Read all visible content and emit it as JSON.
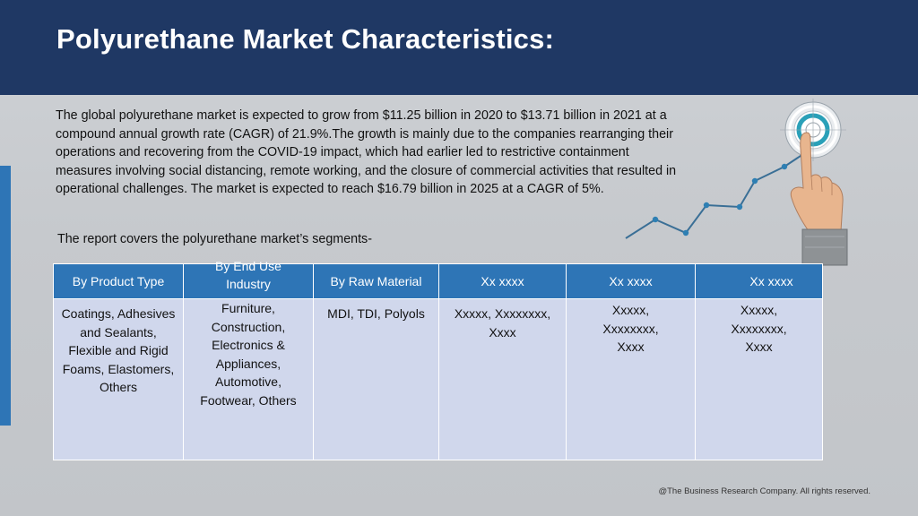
{
  "slide": {
    "title": "Polyurethane Market Characteristics:",
    "intro": "The global polyurethane market is expected to grow from $11.25 billion in 2020 to $13.71 billion in 2021 at a compound annual growth rate (CAGR) of 21.9%.The growth is mainly due to the companies rearranging their operations and recovering from the COVID-19 impact, which had earlier led to restrictive containment measures involving social distancing, remote working, and the closure of commercial activities that resulted in operational challenges. The market is expected to reach $16.79 billion in 2025 at a CAGR of 5%.",
    "segments_note": "The report covers the polyurethane market’s segments-",
    "footer": "@The Business Research Company. All rights reserved."
  },
  "table": {
    "headers": [
      "By Product Type",
      "By End Use Industry",
      "By Raw Material",
      "Xx xxxx",
      "Xx xxxx",
      "Xx xxxx"
    ],
    "cells": [
      "Coatings, Adhesives and Sealants, Flexible and Rigid Foams, Elastomers, Others",
      "Furniture, Construction, Electronics & Appliances, Automotive, Footwear, Others",
      "MDI, TDI, Polyols",
      "Xxxxx, Xxxxxxxx, Xxxx",
      "Xxxxx, Xxxxxxxx, Xxxx",
      "Xxxxx, Xxxxxxxx, Xxxx"
    ]
  },
  "decoration": {
    "icons": [
      "target-icon",
      "pointing-hand-icon",
      "growth-line-icon"
    ],
    "colors": {
      "header": "#1f3864",
      "accent": "#2e75b6",
      "line": "#3a6f96",
      "cell": "#d0d7ec"
    }
  }
}
